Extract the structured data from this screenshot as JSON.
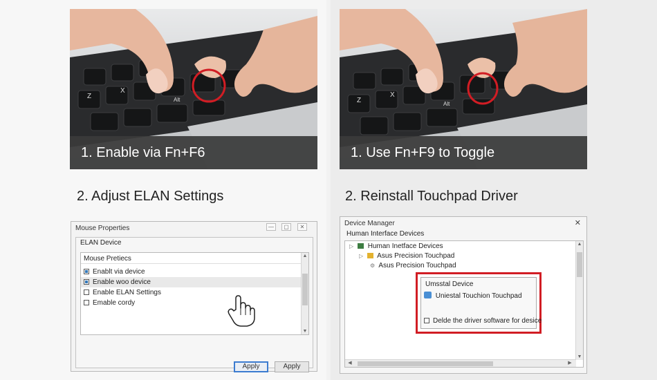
{
  "steps": {
    "fn_f6_caption": "1. Enable via Fn+F6",
    "fn_f9_caption": "1. Use Fn+F9 to Toggle",
    "elan_heading": "2. Adjust ELAN Settings",
    "driver_heading": "2. Reinstall Touchpad Driver"
  },
  "keyboard_keys": {
    "left": [
      "Z",
      "X",
      "Alt"
    ],
    "right": [
      "Z",
      "X",
      "Alt"
    ]
  },
  "mouse_properties": {
    "title": "Mouse Properties",
    "title_buttons": [
      "—",
      "▢",
      "✕"
    ],
    "tab_label": "ELAN Device",
    "list_header": "Mouse Pretiecs",
    "items": [
      {
        "label": "Enablt via device",
        "checked": true
      },
      {
        "label": "Enable woo device",
        "checked": true
      },
      {
        "label": "Enable ELAN Settings",
        "checked": false
      },
      {
        "label": "Emable cordy",
        "checked": false
      }
    ],
    "apply_button": "Apply",
    "apply_button_2": "Apply"
  },
  "device_manager": {
    "title": "Device Manager",
    "close_glyph": "✕",
    "section_label": "Human Interface Devices",
    "tree": {
      "root": "Human Inetface Devices",
      "child": "Asus Precision Touchpad",
      "grandchild": "Asus Precision Touchpad"
    },
    "uninstall_dialog": {
      "title": "Umsstal Device",
      "action": "Uniestal Touchion Touchpad",
      "checkbox_label": "Delde the driver software for desice",
      "checked": false
    }
  },
  "colors": {
    "highlight_red": "#d11d24",
    "caption_bg": "#3a3a3a",
    "primary_button_border": "#3b7bd0"
  }
}
